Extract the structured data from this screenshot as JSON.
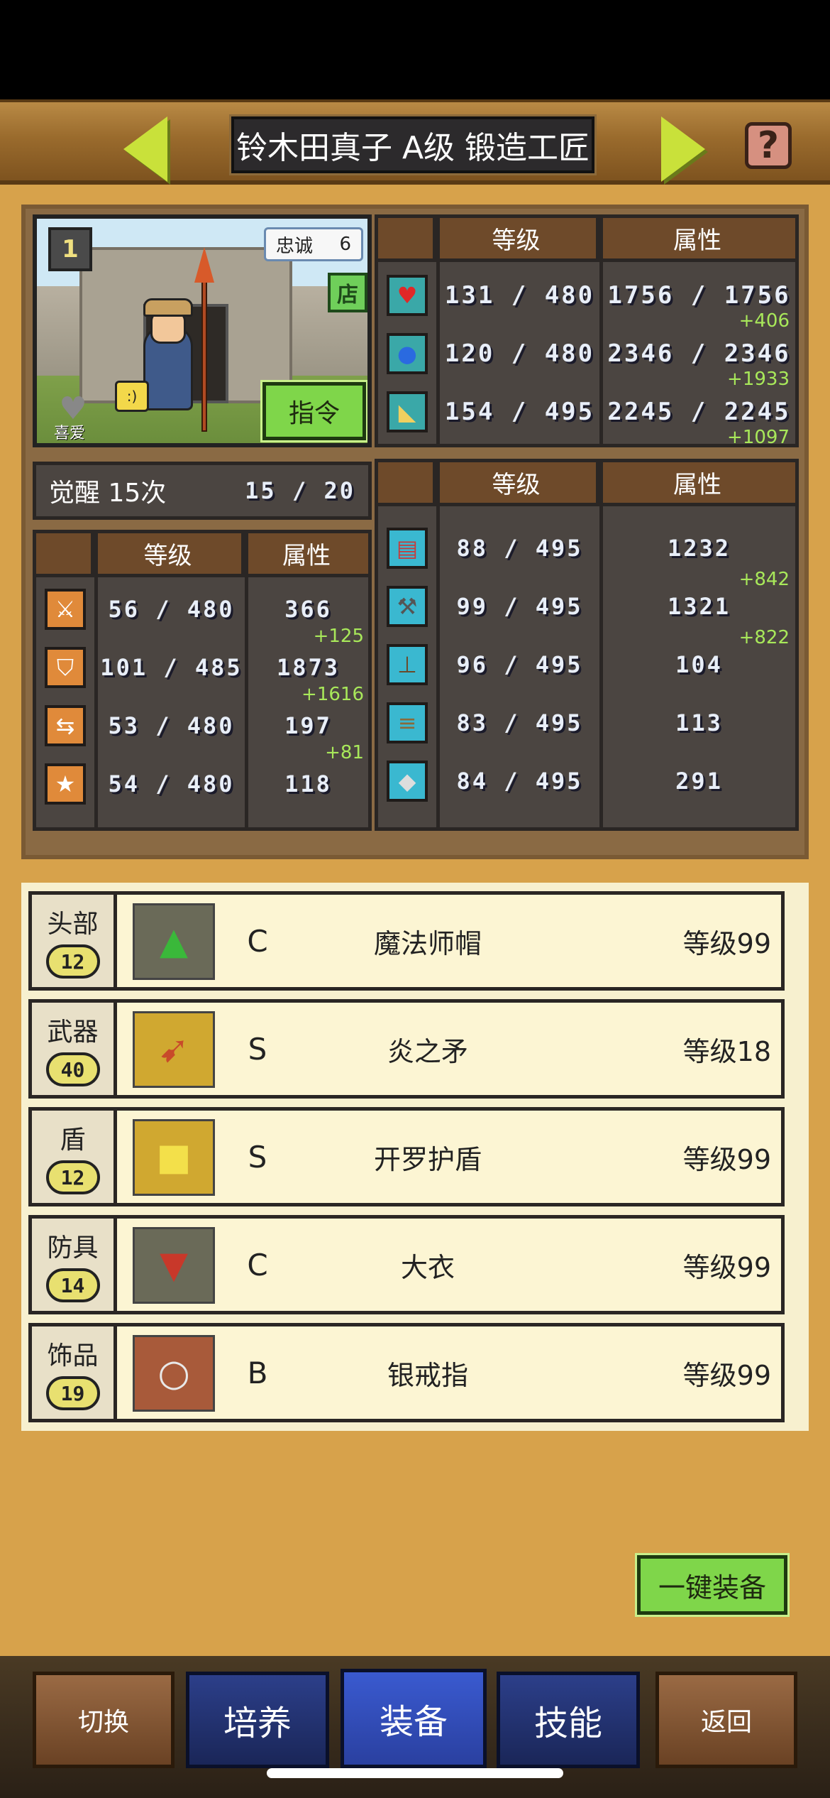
{
  "header": {
    "title": "铃木田真子 A级 锻造工匠",
    "help_icon": "?"
  },
  "character": {
    "rank_badge": "1",
    "loyalty_label": "忠诚",
    "loyalty_value": "6",
    "shop_icon": "店",
    "like_label": "喜爱",
    "command_label": "指令",
    "shield_face": ":)"
  },
  "base_stats": {
    "headers": {
      "level": "等级",
      "attr": "属性"
    },
    "rows": [
      {
        "icon": "heart-icon",
        "level": "131 / 480",
        "attr": "1756 / 1756",
        "bonus": "+406"
      },
      {
        "icon": "potion-icon",
        "level": "120 / 480",
        "attr": "2346 / 2346",
        "bonus": "+1933"
      },
      {
        "icon": "stamina-icon",
        "level": "154 / 495",
        "attr": "2245 / 2245",
        "bonus": "+1097"
      }
    ]
  },
  "awakening": {
    "label": "觉醒 15次",
    "count": "15 /  20"
  },
  "combat_stats": {
    "headers": {
      "level": "等级",
      "attr": "属性"
    },
    "rows": [
      {
        "icon": "attack-icon",
        "level": "56 / 480",
        "attr": "366",
        "bonus": "+125"
      },
      {
        "icon": "defense-icon",
        "level": "101 / 485",
        "attr": "1873",
        "bonus": "+1616"
      },
      {
        "icon": "speed-icon",
        "level": "53 / 480",
        "attr": "197",
        "bonus": "+81"
      },
      {
        "icon": "luck-icon",
        "level": "54 / 480",
        "attr": "118",
        "bonus": ""
      }
    ]
  },
  "craft_stats": {
    "headers": {
      "level": "等级",
      "attr": "属性"
    },
    "rows": [
      {
        "icon": "book-icon",
        "level": "88 / 495",
        "attr": "1232",
        "bonus": "+842"
      },
      {
        "icon": "hammer-icon",
        "level": "99 / 495",
        "attr": "1321",
        "bonus": "+822"
      },
      {
        "icon": "shovel-icon",
        "level": "96 / 495",
        "attr": "104",
        "bonus": ""
      },
      {
        "icon": "anvil-icon",
        "level": "83 / 495",
        "attr": "113",
        "bonus": ""
      },
      {
        "icon": "ore-icon",
        "level": "84 / 495",
        "attr": "291",
        "bonus": ""
      }
    ]
  },
  "equipment": [
    {
      "slot": "头部",
      "slot_level": "12",
      "icon": "wizard-hat-icon",
      "rank": "C",
      "name": "魔法师帽",
      "level": "等级99"
    },
    {
      "slot": "武器",
      "slot_level": "40",
      "icon": "spear-icon",
      "rank": "S",
      "name": "炎之矛",
      "level": "等级18"
    },
    {
      "slot": "盾",
      "slot_level": "12",
      "icon": "shield-icon",
      "rank": "S",
      "name": "开罗护盾",
      "level": "等级99"
    },
    {
      "slot": "防具",
      "slot_level": "14",
      "icon": "coat-icon",
      "rank": "C",
      "name": "大衣",
      "level": "等级99"
    },
    {
      "slot": "饰品",
      "slot_level": "19",
      "icon": "ring-icon",
      "rank": "B",
      "name": "银戒指",
      "level": "等级99"
    }
  ],
  "auto_equip_label": "一键装备",
  "nav": {
    "switch": "切换",
    "train": "培养",
    "equip": "装备",
    "skills": "技能",
    "back": "返回"
  },
  "colors": {
    "background": "#d7a24b",
    "accent_green": "#7fd64a",
    "bonus_green": "#a8e85a",
    "nav_active": "#3a5ad0"
  }
}
